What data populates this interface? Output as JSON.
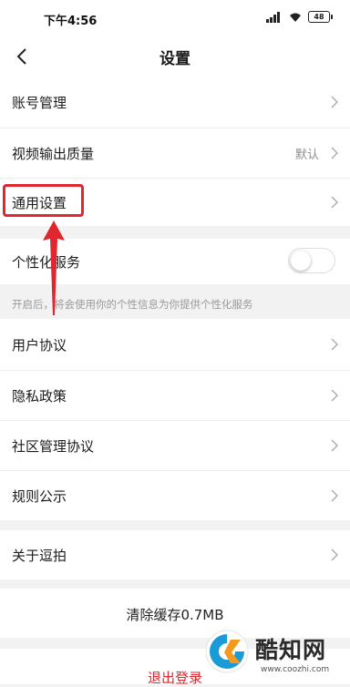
{
  "status_bar": {
    "time": "下午4:56",
    "battery": "48"
  },
  "nav": {
    "title": "设置"
  },
  "settings": {
    "account": "账号管理",
    "video_quality": "视频输出质量",
    "video_quality_value": "默认",
    "general": "通用设置",
    "personalized": "个性化服务",
    "personalized_enabled": false,
    "personalized_hint": "开启后，将会使用你的个性信息为你提供个性化服务",
    "user_agreement": "用户协议",
    "privacy": "隐私政策",
    "community": "社区管理协议",
    "rules": "规则公示",
    "about": "关于逗拍",
    "clear_cache": "清除缓存0.7MB",
    "logout": "退出登录"
  },
  "watermark": {
    "name": "酷知网",
    "url": "www.coozhi.com"
  },
  "colors": {
    "accent_red": "#e0272f",
    "logo_blue": "#1a9ad6",
    "logo_orange": "#f39a1e"
  }
}
